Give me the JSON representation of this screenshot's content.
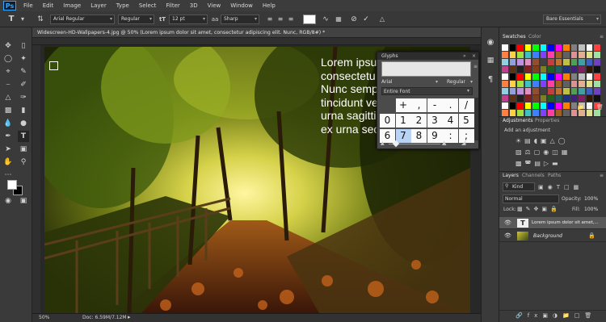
{
  "app": {
    "logo": "Ps"
  },
  "menu": [
    "File",
    "Edit",
    "Image",
    "Layer",
    "Type",
    "Select",
    "Filter",
    "3D",
    "View",
    "Window",
    "Help"
  ],
  "options": {
    "font_family": "Arial Regular",
    "font_style": "Regular",
    "font_size_icon": "tT",
    "font_size": "12 pt",
    "aa_icon": "aa",
    "antialias": "Sharp",
    "workspace": "Bare Essentials"
  },
  "document": {
    "tab_title": "Widescreen-HD-Wallpapers-4.jpg @ 50% (Lorem ipsum dolor sit amet,  consectetur adipiscing elit.  Nunc, RGB/8#) *",
    "zoom": "50%",
    "doc_info": "Doc: 6.59M/7.12M"
  },
  "canvas_text": [
    "Lorem ipsu",
    "consectetu",
    "Nunc semp",
    "tincidunt ve",
    "urna sagitti",
    "ex urna sec"
  ],
  "glyphs": {
    "title": "Glyphs",
    "font": "Arial",
    "style": "Regular",
    "filter": "Entire Font",
    "rows": [
      [
        "+",
        ",",
        "-",
        ".",
        "/"
      ],
      [
        "0",
        "1",
        "2",
        "3",
        "4",
        "5"
      ],
      [
        "6",
        "7",
        "8",
        "9",
        ":",
        ";"
      ]
    ],
    "selected": "7"
  },
  "panels": {
    "swatches_tabs": [
      "Swatches",
      "Color"
    ],
    "adjustments_tabs": [
      "Adjustments",
      "Properties"
    ],
    "add_adjustment": "Add an adjustment",
    "layers_tabs": [
      "Layers",
      "Channels",
      "Paths"
    ],
    "kind": "Kind",
    "blend_mode": "Normal",
    "opacity_label": "Opacity:",
    "opacity": "100%",
    "lock_label": "Lock:",
    "fill_label": "Fill:",
    "fill": "100%",
    "layers": [
      {
        "name": "Lorem ipsum dolor sit amet,...",
        "thumb": "T"
      },
      {
        "name": "Background",
        "thumb": ""
      }
    ]
  },
  "colors": {
    "accent": "#31a8ff",
    "panel": "#3a3a3a",
    "selected_glyph": "#b9d3f5"
  },
  "swatch_colors": [
    "#ffffff",
    "#000000",
    "#ff0000",
    "#ffff00",
    "#00ff00",
    "#00ffff",
    "#0000ff",
    "#ff00ff",
    "#ff8000",
    "#808080",
    "#c0c0c0",
    "#ffffff",
    "#ff4040",
    "#ff8040",
    "#ffd040",
    "#a0e040",
    "#40c0c0",
    "#4080ff",
    "#8040ff",
    "#ff40a0",
    "#a06020",
    "#606060",
    "#e09090",
    "#e0b090",
    "#e0e090",
    "#a0e0a0",
    "#90d0e0",
    "#90a0e0",
    "#c090e0",
    "#e090c0",
    "#905030",
    "#404040",
    "#c04040",
    "#c07030",
    "#c0c040",
    "#50a050",
    "#40a0a0",
    "#4060c0",
    "#7040c0",
    "#c04090",
    "#603010",
    "#202020",
    "#802020",
    "#804020",
    "#808020",
    "#206020",
    "#206060",
    "#203080",
    "#402080",
    "#802060",
    "#301808",
    "#101010"
  ]
}
